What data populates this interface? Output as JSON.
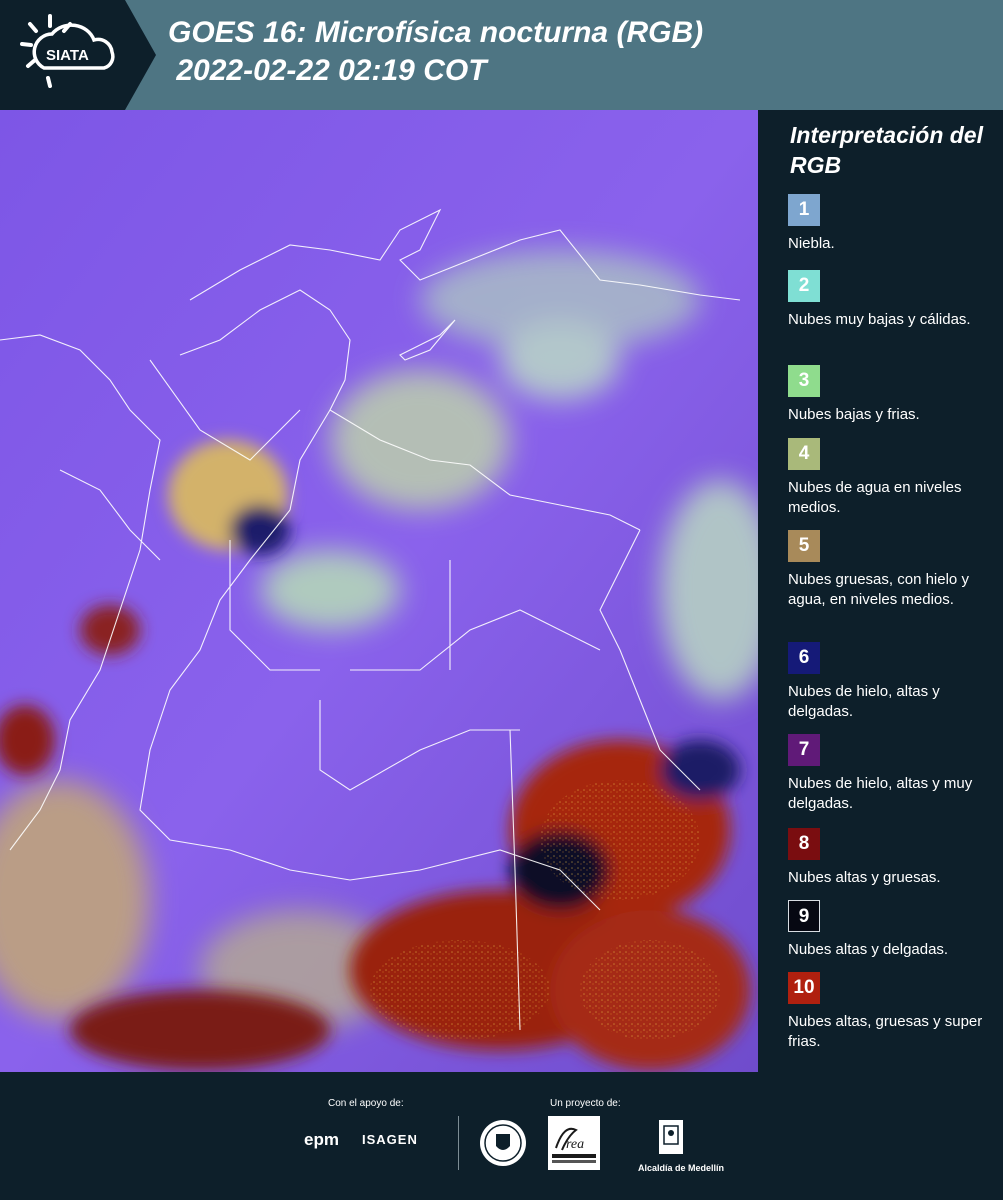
{
  "header": {
    "logo_text": "SIATA",
    "title_line1": "GOES 16: Microfísica nocturna (RGB)",
    "title_line2": " 2022-02-22 02:19 COT"
  },
  "legend": {
    "title": "Interpretación del RGB",
    "items": [
      {
        "num": "1",
        "color": "#7ea6cf",
        "text": "Niebla."
      },
      {
        "num": "2",
        "color": "#7fdfd4",
        "text": "Nubes muy bajas y cálidas."
      },
      {
        "num": "3",
        "color": "#8fdc8d",
        "text": "Nubes bajas y frias."
      },
      {
        "num": "4",
        "color": "#a9b97a",
        "text": "Nubes de agua en niveles medios."
      },
      {
        "num": "5",
        "color": "#a88a5a",
        "text": "Nubes gruesas, con hielo y agua, en niveles medios."
      },
      {
        "num": "6",
        "color": "#151a78",
        "text": "Nubes de hielo, altas y delgadas."
      },
      {
        "num": "7",
        "color": "#601a78",
        "text": "Nubes de hielo, altas y muy delgadas."
      },
      {
        "num": "8",
        "color": "#7a0d10",
        "text": "Nubes altas y gruesas."
      },
      {
        "num": "9",
        "color": "#060812",
        "text": "Nubes altas y delgadas."
      },
      {
        "num": "10",
        "color": "#b0200f",
        "text": "Nubes altas, gruesas y super frias."
      }
    ]
  },
  "footer": {
    "support_label": "Con el apoyo de:",
    "project_label": "Un proyecto de:",
    "sponsor1": "epm",
    "sponsor2": "ISAGEN",
    "partner3": "Alcaldía de Medellín"
  }
}
